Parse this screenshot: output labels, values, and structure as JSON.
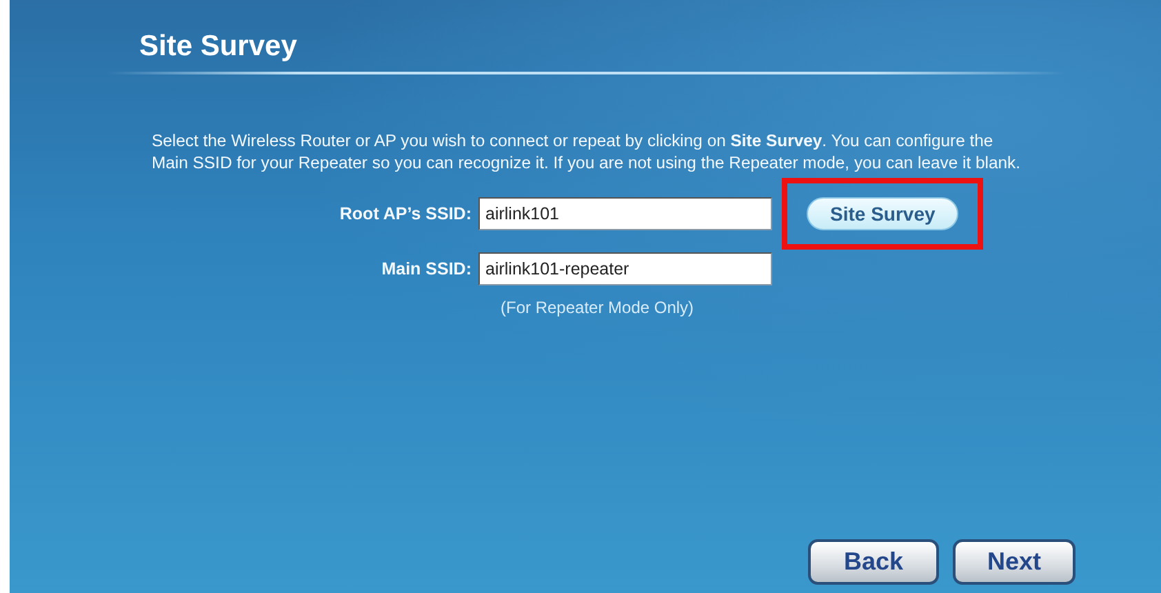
{
  "title": "Site Survey",
  "instructions": "Select the Wireless Router or AP you wish to connect or repeat by clicking on **Site Survey**. You can configure the Main SSID for your Repeater so you can recognize it. If you are not using the Repeater mode, you can leave it blank.",
  "fields": [
    {
      "label": "Root AP’s SSID:",
      "value": "airlink101"
    },
    {
      "label": "Main SSID:",
      "value": "airlink101-repeater"
    }
  ],
  "site_survey_button": {
    "label": "Site Survey",
    "highlighted": true
  },
  "note": "(For Repeater Mode Only)",
  "nav_buttons": [
    "Back",
    "Next"
  ]
}
